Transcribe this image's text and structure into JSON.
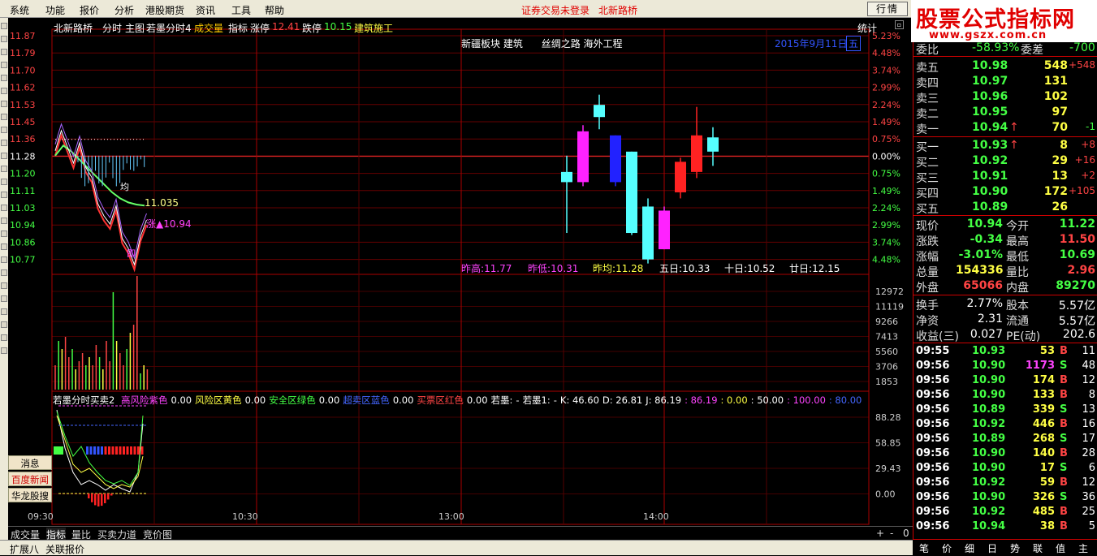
{
  "menubar": {
    "items": [
      "系统",
      "功能",
      "报价",
      "分析",
      "港股期货",
      "资讯",
      "工具",
      "帮助"
    ],
    "status1": "证券交易未登录",
    "status2": "北新路桥",
    "quote_button": "行情"
  },
  "brand": {
    "line1": "股票公式指标网",
    "line2": "www.gszx.com.cn"
  },
  "header": {
    "stock": "北新路桥",
    "mode": "分时",
    "main_label": "主图",
    "main_name": "若墨分时4",
    "vol_label": "成交量",
    "ind_label": "指标",
    "zt_label": "涨停",
    "zt_value": "12.41",
    "dt_label": "跌停",
    "dt_value": "10.15",
    "sector": "建筑施工",
    "stats": "统计",
    "date": "2015年9月11日",
    "weekday": "五",
    "concepts": "新疆板块 建筑      丝绸之路 海外工程"
  },
  "price_axis": {
    "left": [
      "11.87",
      "11.79",
      "11.70",
      "11.62",
      "11.53",
      "11.45",
      "11.36",
      "11.28",
      "11.20",
      "11.11",
      "11.03",
      "10.94",
      "10.86",
      "10.77"
    ],
    "right": [
      "5.23%",
      "4.48%",
      "3.74%",
      "2.99%",
      "2.24%",
      "1.49%",
      "0.75%",
      "0.00%",
      "0.75%",
      "1.49%",
      "2.24%",
      "2.99%",
      "3.74%",
      "4.48%"
    ]
  },
  "vol_axis": [
    "12972",
    "11119",
    "9266",
    "7413",
    "5560",
    "3706",
    "1853"
  ],
  "ind_axis": [
    "88.28",
    "58.85",
    "29.43",
    "0.00"
  ],
  "time_axis": [
    "09:30",
    "10:30",
    "13:00",
    "14:00"
  ],
  "avg_label": "均",
  "avg_value_label": "11.035",
  "rise_label": "涨▲10.94",
  "low_label": "即",
  "history": {
    "zg_label": "昨高",
    "zg": "11.77",
    "zd_label": "昨低",
    "zd": "10.31",
    "zj_label": "昨均",
    "zj": "11.28",
    "w5_label": "五日",
    "w5": "10.33",
    "w10_label": "十日",
    "w10": "10.52",
    "w20_label": "廿日",
    "w20": "12.15"
  },
  "indicator": {
    "name": "若墨分时买卖2",
    "items": [
      {
        "label": "高风险紫色",
        "value": "0.00",
        "color": "#ff44ff"
      },
      {
        "label": "风险区黄色",
        "value": "0.00",
        "color": "#ffff44"
      },
      {
        "label": "安全区绿色",
        "value": "0.00",
        "color": "#44ff44"
      },
      {
        "label": "超卖区蓝色",
        "value": "0.00",
        "color": "#4466ff"
      },
      {
        "label": "买票区红色",
        "value": "0.00",
        "color": "#ff4444"
      }
    ],
    "tail": [
      {
        "text": "若墨:",
        "color": "#ffffff"
      },
      {
        "text": "-",
        "color": "#ffffff"
      },
      {
        "text": "若墨1:",
        "color": "#ffffff"
      },
      {
        "text": "-",
        "color": "#ffffff"
      },
      {
        "text": "K: 46.60",
        "color": "#ffffff"
      },
      {
        "text": "D: 26.81",
        "color": "#ffffff"
      },
      {
        "text": "J: 86.19",
        "color": "#ffffff"
      },
      {
        "text": ": 86.19",
        "color": "#ff44ff"
      },
      {
        "text": ": 0.00",
        "color": "#ffff44"
      },
      {
        "text": ": 50.00",
        "color": "#ffffff"
      },
      {
        "text": ": 100.00",
        "color": "#ff44ff"
      },
      {
        "text": ": 80.00",
        "color": "#4466ff"
      }
    ]
  },
  "left_buttons": [
    "消息",
    "百度新闻",
    "华龙股搜"
  ],
  "tabs": [
    "成交量",
    "指标",
    "量比",
    "买卖力道",
    "竞价图"
  ],
  "tab_controls": [
    "+",
    "-",
    "0"
  ],
  "statusbar": [
    "扩展八",
    "关联报价"
  ],
  "order_book": {
    "top_label": "委比",
    "top_value": "-58.93%",
    "top_label2": "委差",
    "top_value2": "-700",
    "sells": [
      {
        "label": "卖五",
        "price": "10.98",
        "vol": "548",
        "chg": "+548",
        "arrow": ""
      },
      {
        "label": "卖四",
        "price": "10.97",
        "vol": "131",
        "chg": "",
        "arrow": ""
      },
      {
        "label": "卖三",
        "price": "10.96",
        "vol": "102",
        "chg": "",
        "arrow": ""
      },
      {
        "label": "卖二",
        "price": "10.95",
        "vol": "97",
        "chg": "",
        "arrow": ""
      },
      {
        "label": "卖一",
        "price": "10.94",
        "vol": "70",
        "chg": "-1",
        "arrow": "↑"
      }
    ],
    "buys": [
      {
        "label": "买一",
        "price": "10.93",
        "vol": "8",
        "chg": "+8",
        "arrow": "↑"
      },
      {
        "label": "买二",
        "price": "10.92",
        "vol": "29",
        "chg": "+16",
        "arrow": ""
      },
      {
        "label": "买三",
        "price": "10.91",
        "vol": "13",
        "chg": "+2",
        "arrow": ""
      },
      {
        "label": "买四",
        "price": "10.90",
        "vol": "172",
        "chg": "+105",
        "arrow": ""
      },
      {
        "label": "买五",
        "price": "10.89",
        "vol": "26",
        "chg": "",
        "arrow": ""
      }
    ]
  },
  "stats": [
    {
      "l1": "现价",
      "v1": "10.94",
      "c1": "#44ff44",
      "l2": "今开",
      "v2": "11.22",
      "c2": "#44ff44"
    },
    {
      "l1": "涨跌",
      "v1": "-0.34",
      "c1": "#44ff44",
      "l2": "最高",
      "v2": "11.50",
      "c2": "#ff4444"
    },
    {
      "l1": "涨幅",
      "v1": "-3.01%",
      "c1": "#44ff44",
      "l2": "最低",
      "v2": "10.69",
      "c2": "#44ff44"
    },
    {
      "l1": "总量",
      "v1": "154336",
      "c1": "#ffff44",
      "l2": "量比",
      "v2": "2.96",
      "c2": "#ff4444"
    },
    {
      "l1": "外盘",
      "v1": "65066",
      "c1": "#ff4444",
      "l2": "内盘",
      "v2": "89270",
      "c2": "#44ff44"
    }
  ],
  "stats2": [
    {
      "l1": "换手",
      "v1": "2.77%",
      "l2": "股本",
      "v2": "5.57亿"
    },
    {
      "l1": "净资",
      "v1": "2.31",
      "l2": "流通",
      "v2": "5.57亿"
    },
    {
      "l1": "收益(三)",
      "v1": "0.027",
      "l2": "PE(动)",
      "v2": "202.6"
    }
  ],
  "trades": [
    {
      "t": "09:55",
      "p": "10.93",
      "v": "53",
      "s": "B",
      "n": "11",
      "vc": "#ffff44"
    },
    {
      "t": "09:56",
      "p": "10.90",
      "v": "1173",
      "s": "S",
      "n": "48",
      "vc": "#ff44ff"
    },
    {
      "t": "09:56",
      "p": "10.90",
      "v": "174",
      "s": "B",
      "n": "12",
      "vc": "#ffff44"
    },
    {
      "t": "09:56",
      "p": "10.90",
      "v": "133",
      "s": "B",
      "n": "8",
      "vc": "#ffff44"
    },
    {
      "t": "09:56",
      "p": "10.89",
      "v": "339",
      "s": "S",
      "n": "13",
      "vc": "#ffff44"
    },
    {
      "t": "09:56",
      "p": "10.92",
      "v": "446",
      "s": "B",
      "n": "16",
      "vc": "#ffff44"
    },
    {
      "t": "09:56",
      "p": "10.89",
      "v": "268",
      "s": "S",
      "n": "17",
      "vc": "#ffff44"
    },
    {
      "t": "09:56",
      "p": "10.90",
      "v": "140",
      "s": "B",
      "n": "28",
      "vc": "#ffff44"
    },
    {
      "t": "09:56",
      "p": "10.90",
      "v": "17",
      "s": "S",
      "n": "6",
      "vc": "#ffff44"
    },
    {
      "t": "09:56",
      "p": "10.92",
      "v": "59",
      "s": "B",
      "n": "12",
      "vc": "#ffff44"
    },
    {
      "t": "09:56",
      "p": "10.90",
      "v": "326",
      "s": "S",
      "n": "36",
      "vc": "#ffff44"
    },
    {
      "t": "09:56",
      "p": "10.92",
      "v": "485",
      "s": "B",
      "n": "25",
      "vc": "#ffff44"
    },
    {
      "t": "09:56",
      "p": "10.94",
      "v": "38",
      "s": "B",
      "n": "5",
      "vc": "#ffff44"
    }
  ],
  "right_tabs": [
    "笔",
    "价",
    "细",
    "日",
    "势",
    "联",
    "值",
    "主"
  ],
  "chart_data": {
    "type": "line",
    "price": [
      11.28,
      11.38,
      11.3,
      11.22,
      11.32,
      11.2,
      11.15,
      11.02,
      10.96,
      10.92,
      11.01,
      10.85,
      10.8,
      10.72,
      10.86,
      10.94
    ],
    "avg": [
      11.28,
      11.33,
      11.3,
      11.26,
      11.22,
      11.18,
      11.14,
      11.1,
      11.07,
      11.05,
      11.04,
      11.035
    ],
    "candles": [
      {
        "o": 11.2,
        "h": 11.28,
        "l": 10.9,
        "c": 11.15,
        "up": false
      },
      {
        "o": 11.15,
        "h": 11.43,
        "l": 11.13,
        "c": 11.4,
        "up": true
      },
      {
        "o": 11.47,
        "h": 11.58,
        "l": 11.41,
        "c": 11.53,
        "up": false
      },
      {
        "o": 11.38,
        "h": 11.38,
        "l": 11.13,
        "c": 11.15,
        "up": false
      },
      {
        "o": 11.3,
        "h": 11.3,
        "l": 10.89,
        "c": 10.9,
        "up": false
      },
      {
        "o": 11.03,
        "h": 11.07,
        "l": 10.75,
        "c": 10.77,
        "up": false
      },
      {
        "o": 10.82,
        "h": 11.03,
        "l": 10.82,
        "c": 11.01,
        "up": true
      },
      {
        "o": 11.1,
        "h": 11.27,
        "l": 11.07,
        "c": 11.25,
        "up": true
      },
      {
        "o": 11.2,
        "h": 11.52,
        "l": 11.17,
        "c": 11.38,
        "up": true
      },
      {
        "o": 11.3,
        "h": 11.42,
        "l": 11.23,
        "c": 11.37,
        "up": false
      }
    ]
  }
}
